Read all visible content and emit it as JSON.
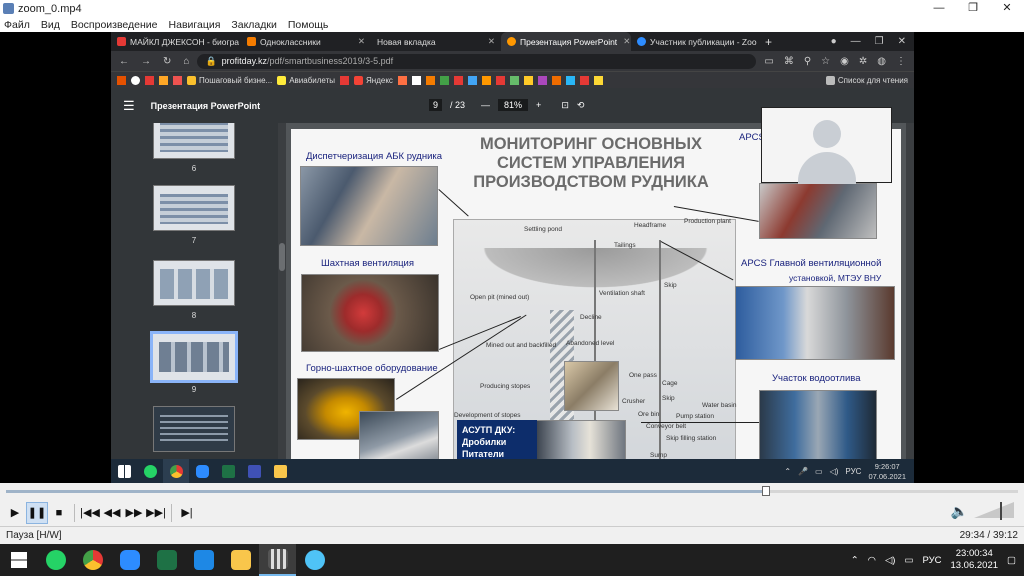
{
  "window": {
    "title": "zoom_0.mp4",
    "controls": [
      "—",
      "❐",
      "✕"
    ]
  },
  "menu": [
    "Файл",
    "Вид",
    "Воспроизведение",
    "Навигация",
    "Закладки",
    "Помощь"
  ],
  "browser": {
    "tabs": [
      {
        "label": "МАЙКЛ ДЖЕКСОН - биогра",
        "color": "#e53935",
        "active": false
      },
      {
        "label": "Одноклассники",
        "color": "#f57c00",
        "active": false
      },
      {
        "label": "Новая вкладка",
        "color": "#9e9e9e",
        "active": false
      },
      {
        "label": "Презентация PowerPoint",
        "color": "#ff9800",
        "active": true
      },
      {
        "label": "Участник публикации - Zoo",
        "color": "#2d8cff",
        "active": false
      }
    ],
    "url_host": "profitday.kz",
    "url_path": "/pdf/smartbusiness2019/3-5.pdf",
    "bookmarks": [
      "Пошаговый бизне...",
      "Авиабилеты",
      "Яндекс"
    ],
    "reading_list": "Список для чтения"
  },
  "pdf": {
    "title": "Презентация PowerPoint",
    "page": "9",
    "total": "/ 23",
    "zoom": "81%",
    "thumb_numbers": [
      "6",
      "7",
      "8",
      "9"
    ]
  },
  "slide": {
    "title": "МОНИТОРИНГ ОСНОВНЫХ СИСТЕМ УПРАВЛЕНИЯ ПРОИЗВОДСТВОМ РУДНИКА",
    "labels": {
      "dispatch": "Диспетчеризация  АБК рудника",
      "vent": "Шахтная вентиляция",
      "equip": "Горно-шахтное оборудование",
      "apcs_top": "APCS",
      "apcs_main_1": "APCS Главной вентиляционной",
      "apcs_main_2": "установкой, МТЭУ ВНУ",
      "drain": "Участок водоотлива",
      "asutp_1": "АСУТП ДКУ:",
      "asutp_2": "Дробилки",
      "asutp_3": "Питатели"
    },
    "diagram_labels": [
      "Settling pond",
      "Headframe",
      "Production plant",
      "Tailings",
      "Open pit (mined out)",
      "Ventilation shaft",
      "Skip",
      "Decline",
      "Abandoned level",
      "Mined out and backfilled",
      "Producing stopes",
      "One pass",
      "Cage",
      "Skip",
      "Crusher",
      "Ore bin",
      "Water basin",
      "Pump station",
      "Conveyor belt",
      "Development of stopes",
      "Skip filling station",
      "Sump"
    ]
  },
  "guest_taskbar": {
    "time": "9:26:07",
    "date": "07.06.2021",
    "lang": "РУС"
  },
  "player": {
    "progress": 0.751,
    "status": "Пауза [H/W]",
    "time": "29:34 / 39:12",
    "volume": 0.7
  },
  "host_taskbar": {
    "time": "23:00:34",
    "date": "13.06.2021",
    "lang": "РУС"
  }
}
